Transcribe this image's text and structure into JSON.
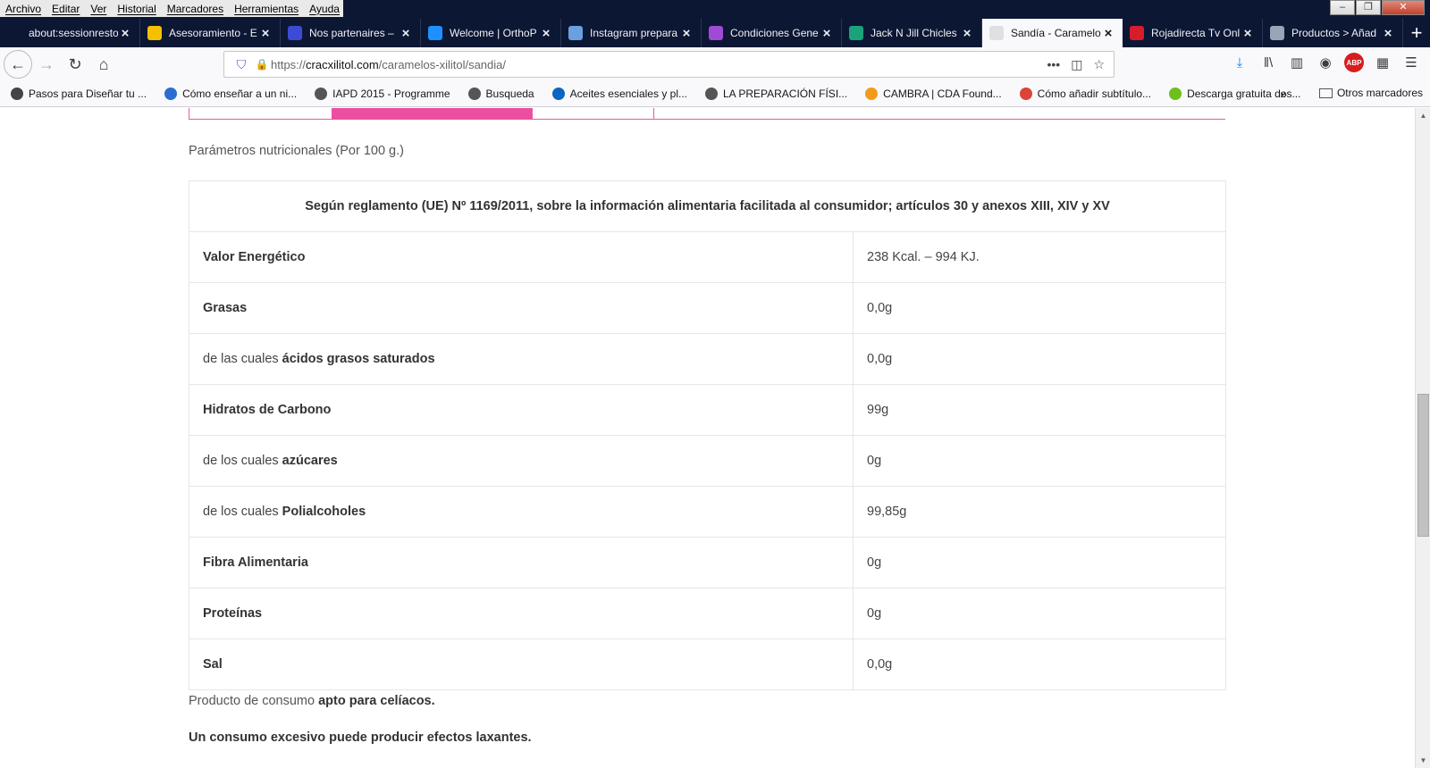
{
  "menubar": [
    "Archivo",
    "Editar",
    "Ver",
    "Historial",
    "Marcadores",
    "Herramientas",
    "Ayuda"
  ],
  "tabs": [
    {
      "label": "about:sessionrestore",
      "color": "#0c1734"
    },
    {
      "label": "Asesoramiento - E",
      "color": "#f5c000"
    },
    {
      "label": "Nos partenaires –",
      "color": "#3b4bd6"
    },
    {
      "label": "Welcome | OrthoP",
      "color": "#1e90ff"
    },
    {
      "label": "Instagram prepara",
      "color": "#6aa0e0"
    },
    {
      "label": "Condiciones Gene",
      "color": "#a14ad6"
    },
    {
      "label": "Jack N Jill Chicles |",
      "color": "#1aa37a"
    },
    {
      "label": "Sandía - Caramelo",
      "color": "#e0e0e0"
    },
    {
      "label": "Rojadirecta Tv Onl",
      "color": "#d61d2a"
    },
    {
      "label": "Productos > Añad",
      "color": "#9aa4b8"
    }
  ],
  "url": {
    "prefix": "https://",
    "domain": "cracxilitol.com",
    "path": "/caramelos-xilitol/sandia/"
  },
  "bookmarks": [
    {
      "label": "Pasos para Diseñar tu ...",
      "color": "#444"
    },
    {
      "label": "Cómo enseñar a un ni...",
      "color": "#2a6fcf"
    },
    {
      "label": "IAPD 2015 - Programme",
      "color": "#555"
    },
    {
      "label": "Busqueda",
      "color": "#555"
    },
    {
      "label": "Aceites esenciales y pl...",
      "color": "#0a66c2"
    },
    {
      "label": "LA PREPARACIÓN FÍSI...",
      "color": "#555"
    },
    {
      "label": "CAMBRA | CDA Found...",
      "color": "#f29a1a"
    },
    {
      "label": "Cómo añadir subtítulo...",
      "color": "#db4437"
    },
    {
      "label": "Descarga gratuita des...",
      "color": "#6fbf1a"
    }
  ],
  "bookmarks_other": "Otros marcadores",
  "page": {
    "params_title": "Parámetros nutricionales (Por 100 g.)",
    "table_header": "Según reglamento (UE) Nº 1169/2011, sobre la información alimentaria facilitada al consumidor; artículos 30 y anexos XIII, XIV y XV",
    "rows": [
      {
        "prefix": "",
        "label": "Valor Energético",
        "value": "238 Kcal. – 994 KJ."
      },
      {
        "prefix": "",
        "label": "Grasas",
        "value": "0,0g"
      },
      {
        "prefix": "de las cuales ",
        "label": "ácidos grasos saturados",
        "value": "0,0g"
      },
      {
        "prefix": "",
        "label": "Hidratos de Carbono",
        "value": "99g"
      },
      {
        "prefix": "de los cuales ",
        "label": "azúcares",
        "value": "0g"
      },
      {
        "prefix": "de los cuales ",
        "label": "Polialcoholes",
        "value": "99,85g"
      },
      {
        "prefix": "",
        "label": "Fibra Alimentaria",
        "value": "0g"
      },
      {
        "prefix": "",
        "label": "Proteínas",
        "value": "0g"
      },
      {
        "prefix": "",
        "label": "Sal",
        "value": "0,0g"
      }
    ],
    "note1_prefix": "Producto de consumo ",
    "note1_bold": "apto para celíacos.",
    "note2": "Un consumo excesivo puede producir efectos laxantes."
  },
  "accent_color": "#ec4f9f"
}
